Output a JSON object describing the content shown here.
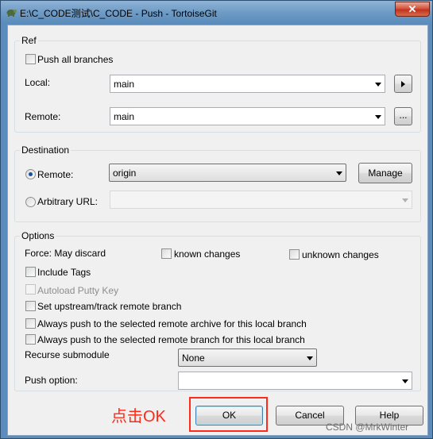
{
  "window": {
    "title": "E:\\C_CODE测试\\C_CODE - Push - TortoiseGit",
    "close_label": "✕"
  },
  "ref": {
    "group_label": "Ref",
    "push_all_branches": {
      "label": "Push all branches",
      "checked": false
    },
    "local": {
      "label": "Local:",
      "value": "main"
    },
    "remote": {
      "label": "Remote:",
      "value": "main",
      "browse_label": "..."
    }
  },
  "destination": {
    "group_label": "Destination",
    "remote_radio": {
      "label": "Remote:",
      "checked": true,
      "value": "origin"
    },
    "manage_label": "Manage",
    "arbitrary_radio": {
      "label": "Arbitrary URL:",
      "checked": false,
      "value": ""
    }
  },
  "options": {
    "group_label": "Options",
    "force_label": "Force: May discard",
    "known_changes": {
      "label": "known changes",
      "checked": false
    },
    "unknown_changes": {
      "label": "unknown changes",
      "checked": false
    },
    "include_tags": {
      "label": "Include Tags",
      "checked": false
    },
    "autoload_putty": {
      "label": "Autoload Putty Key",
      "checked": false,
      "enabled": false
    },
    "set_upstream": {
      "label": "Set upstream/track remote branch",
      "checked": false
    },
    "push_archive": {
      "label": "Always push to the selected remote archive for this local branch",
      "checked": false
    },
    "push_branch": {
      "label": "Always push to the selected remote branch for this local branch",
      "checked": false
    },
    "recurse": {
      "label": "Recurse submodule",
      "value": "None"
    },
    "push_option": {
      "label": "Push option:",
      "value": ""
    }
  },
  "buttons": {
    "ok": "OK",
    "cancel": "Cancel",
    "help": "Help"
  },
  "annotation": {
    "text": "点击OK",
    "color": "#ff2a1a"
  },
  "watermark": "CSDN @MrkWinter",
  "colors": {
    "accent": "#1a4f9c",
    "annotation": "#ff2a1a",
    "titlebar": "#6f9cc6"
  }
}
